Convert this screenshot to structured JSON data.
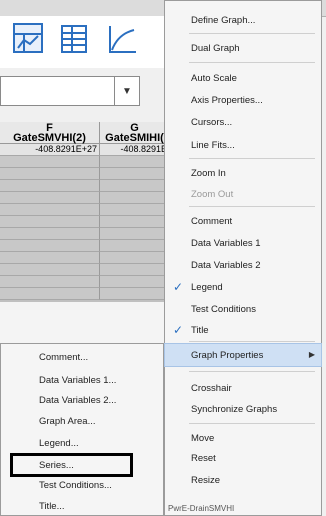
{
  "toolbar": {
    "icons": [
      "graph-view-icon",
      "table-view-icon",
      "line-chart-icon"
    ]
  },
  "table": {
    "columns": [
      {
        "letter": "F",
        "name": "GateSMVHI(2)"
      },
      {
        "letter": "G",
        "name": "GateSMIHI("
      }
    ],
    "first_row": [
      "-408.8291E+27",
      "-408.8291E"
    ]
  },
  "main_menu": {
    "items": [
      "Define Graph...",
      "Dual Graph",
      "Auto Scale",
      "Axis Properties...",
      "Cursors...",
      "Line Fits...",
      "Zoom In",
      "Zoom Out",
      "Comment",
      "Data Variables 1",
      "Data Variables 2",
      "Legend",
      "Test Conditions",
      "Title",
      "Graph Properties",
      "Crosshair",
      "Synchronize Graphs",
      "Move",
      "Reset",
      "Resize"
    ],
    "partial_next": "PwrE-DrainSMVHI"
  },
  "sub_menu": {
    "items": [
      "Comment...",
      "Data Variables 1...",
      "Data Variables 2...",
      "Graph Area...",
      "Legend...",
      "Series...",
      "Test Conditions...",
      "Title..."
    ]
  },
  "colors": {
    "highlight": "#cfe0f4",
    "check": "#2b6fc0",
    "icon": "#2b6fc0"
  }
}
